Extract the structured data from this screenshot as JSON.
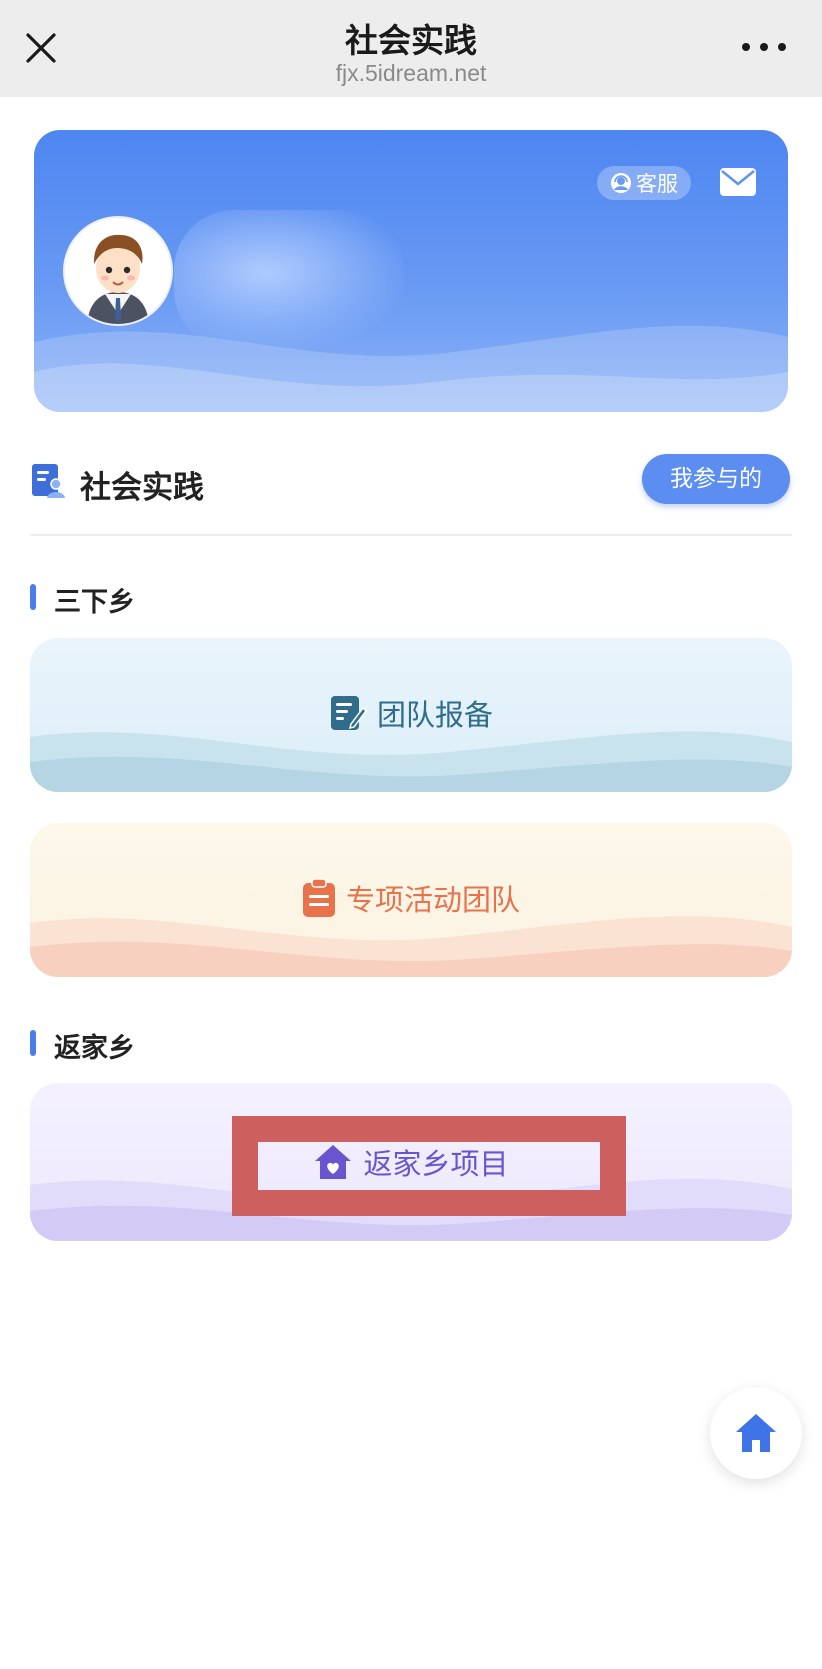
{
  "navbar": {
    "title": "社会实践",
    "url": "fjx.5idream.net"
  },
  "profile": {
    "service_label": "客服"
  },
  "section": {
    "title": "社会实践",
    "my_participation_label": "我参与的"
  },
  "groups": [
    {
      "label": "三下乡",
      "tiles": [
        {
          "label": "团队报备",
          "icon": "edit-document-icon",
          "color": "#2f6d8a"
        },
        {
          "label": "专项活动团队",
          "icon": "clipboard-icon",
          "color": "#e8734a"
        }
      ]
    },
    {
      "label": "返家乡",
      "tiles": [
        {
          "label": "返家乡项目",
          "icon": "heart-house-icon",
          "color": "#6a55cf"
        }
      ]
    }
  ],
  "colors": {
    "accent": "#5b8ef0",
    "highlight_box": "#cd5f5f"
  },
  "floating": {
    "icon": "home-icon"
  }
}
